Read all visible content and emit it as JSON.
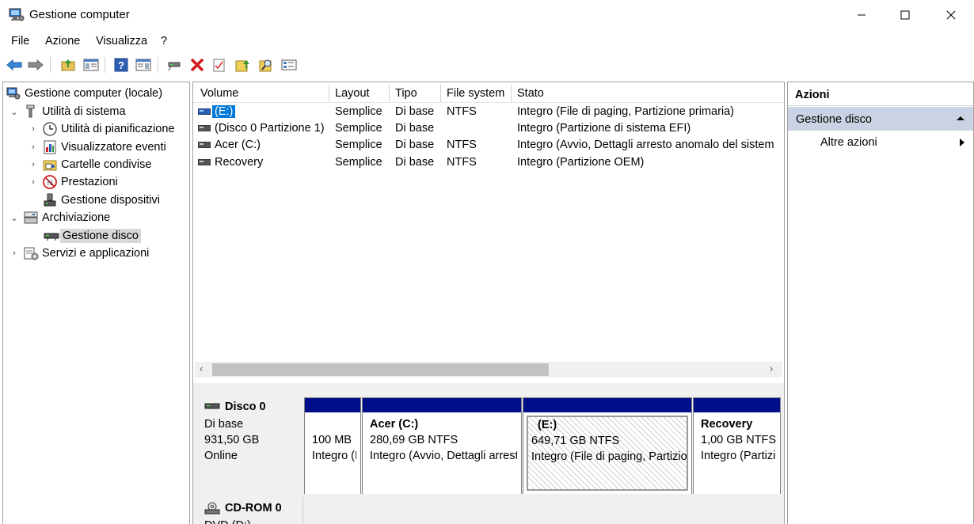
{
  "window": {
    "title": "Gestione computer"
  },
  "menu": {
    "items": [
      "File",
      "Azione",
      "Visualizza",
      "?"
    ]
  },
  "toolbar": {
    "icons": [
      "back-arrow-icon",
      "forward-arrow-icon",
      "up-folder-icon",
      "show-hide-tree-icon",
      "help-icon",
      "show-hide-actions-icon",
      "connect-icon",
      "delete-icon",
      "check-icon",
      "folder-up-icon",
      "search-icon",
      "properties-icon"
    ]
  },
  "tree": {
    "root": "Gestione computer (locale)",
    "system_tools": "Utilità di sistema",
    "scheduler": "Utilità di pianificazione",
    "event_viewer": "Visualizzatore eventi",
    "shared_folders": "Cartelle condivise",
    "performance": "Prestazioni",
    "device_manager": "Gestione dispositivi",
    "storage": "Archiviazione",
    "disk_management": "Gestione disco",
    "services": "Servizi e applicazioni"
  },
  "volumes": {
    "headers": [
      "Volume",
      "Layout",
      "Tipo",
      "File system",
      "Stato"
    ],
    "rows": [
      {
        "volume": "(E:)",
        "layout": "Semplice",
        "tipo": "Di base",
        "fs": "NTFS",
        "stato": "Integro (File di paging, Partizione primaria)"
      },
      {
        "volume": "(Disco 0 Partizione 1)",
        "layout": "Semplice",
        "tipo": "Di base",
        "fs": "",
        "stato": "Integro (Partizione di sistema EFI)"
      },
      {
        "volume": "Acer (C:)",
        "layout": "Semplice",
        "tipo": "Di base",
        "fs": "NTFS",
        "stato": "Integro (Avvio, Dettagli arresto anomalo del sistem"
      },
      {
        "volume": "Recovery",
        "layout": "Semplice",
        "tipo": "Di base",
        "fs": "NTFS",
        "stato": "Integro (Partizione OEM)"
      }
    ]
  },
  "disks": {
    "disk0": {
      "name": "Disco 0",
      "type": "Di base",
      "size": "931,50 GB",
      "status": "Online",
      "partitions": [
        {
          "title": "",
          "size": "100 MB",
          "status": "Integro (Partizione di sistema EFI)"
        },
        {
          "title": "Acer  (C:)",
          "size": "280,69 GB NTFS",
          "status": "Integro (Avvio, Dettagli arresto anomalo del sistema)"
        },
        {
          "title": "(E:)",
          "size": "649,71 GB NTFS",
          "status": "Integro (File di paging, Partizione primaria)"
        },
        {
          "title": "Recovery",
          "size": "1,00 GB NTFS",
          "status": "Integro (Partizione OEM)"
        }
      ]
    },
    "cdrom0": {
      "name": "CD-ROM 0",
      "type": "DVD (D:)"
    }
  },
  "actions": {
    "header": "Azioni",
    "section": "Gestione disco",
    "more": "Altre azioni"
  },
  "colors": {
    "partition_bar": "#000e8a",
    "selection": "#0078d7",
    "actions_section": "#c9d3e3"
  }
}
